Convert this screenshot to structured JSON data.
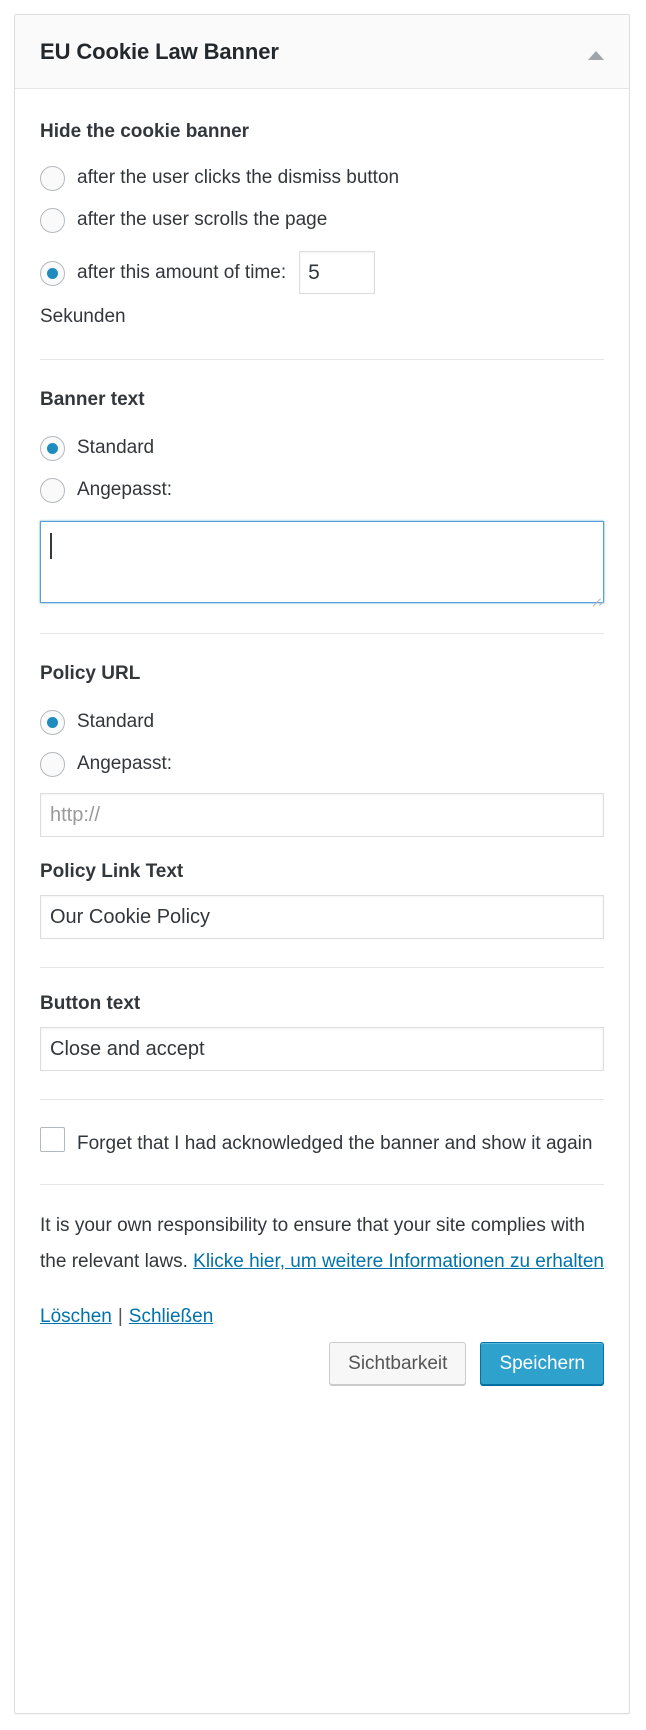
{
  "widget": {
    "title": "EU Cookie Law Banner",
    "collapse_icon": "caret-up-icon"
  },
  "hide_banner": {
    "heading": "Hide the cookie banner",
    "options": [
      {
        "label": "after the user clicks the dismiss button",
        "checked": false
      },
      {
        "label": "after the user scrolls the page",
        "checked": false
      },
      {
        "label": "after this amount of time:",
        "checked": true
      }
    ],
    "time_value": "5",
    "time_unit": "Sekunden"
  },
  "banner_text": {
    "heading": "Banner text",
    "option_default": "Standard",
    "option_custom": "Angepasst:",
    "default_checked": true,
    "custom_checked": false,
    "textarea_value": ""
  },
  "policy_url": {
    "heading": "Policy URL",
    "option_default": "Standard",
    "option_custom": "Angepasst:",
    "default_checked": true,
    "custom_checked": false,
    "url_placeholder": "http://",
    "url_value": ""
  },
  "policy_link_text": {
    "heading": "Policy Link Text",
    "value": "Our Cookie Policy"
  },
  "button_text": {
    "heading": "Button text",
    "value": "Close and accept"
  },
  "forget": {
    "label": "Forget that I had acknowledged the banner and show it again",
    "checked": false
  },
  "disclaimer": {
    "text": "It is your own responsibility to ensure that your site complies with the relevant laws.",
    "link": "Klicke hier, um weitere Informationen zu erhalten"
  },
  "footer": {
    "delete_label": "Löschen",
    "separator": "|",
    "close_label": "Schließen",
    "visibility_label": "Sichtbarkeit",
    "save_label": "Speichern"
  },
  "colors": {
    "accent": "#1e8cbe",
    "link": "#0073aa",
    "primary_button": "#2ea2cc",
    "focus_border": "#5b9dd9",
    "text": "#32373c",
    "panel_border": "#dddddd"
  }
}
